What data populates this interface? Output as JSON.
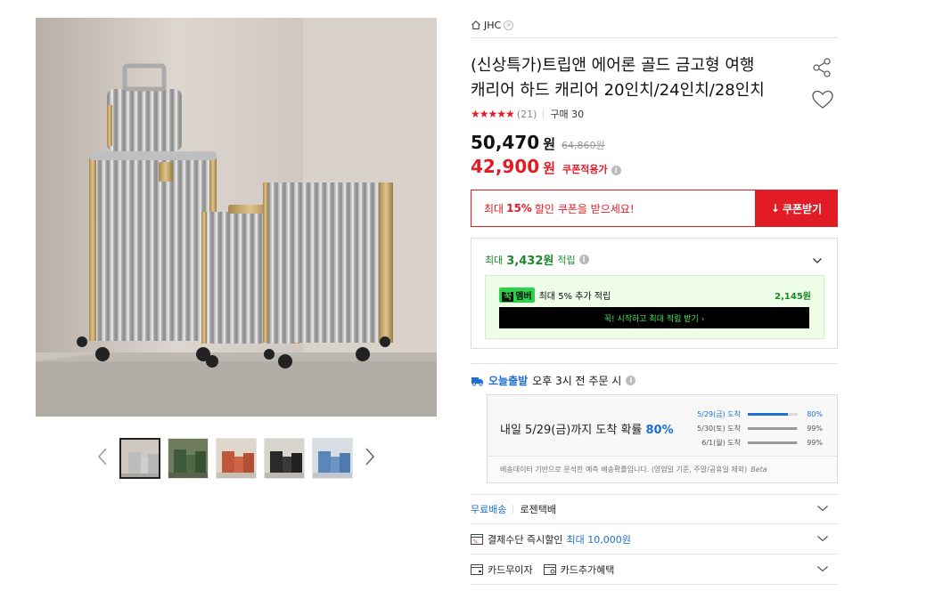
{
  "gallery": {
    "prev_arrow": "‹",
    "next_arrow": "›",
    "thumbnails": [
      "thumb-silver",
      "thumb-green",
      "thumb-orange",
      "thumb-black",
      "thumb-blue"
    ]
  },
  "brand": {
    "name": "JHC",
    "arrow": ">"
  },
  "product": {
    "title_line1": "(신상특가)트립앤 에어론 골드 금고형 여행",
    "title_line2": "캐리어 하드 캐리어 20인치/24인치/28인치",
    "stars": "★★★★★",
    "review_count": "(21)",
    "purchase": "구매 30"
  },
  "price": {
    "sale": "50,470",
    "won": "원",
    "original": "64,860원",
    "coupon_price": "42,900",
    "coupon_label": "쿠폰적용가",
    "info_icon": "i"
  },
  "coupon": {
    "msg_pre": "최대",
    "msg_pct": "15%",
    "msg_post": "할인 쿠폰을 받으세요!",
    "button": "쿠폰받기",
    "button_icon": "↓"
  },
  "points": {
    "pre": "최대",
    "amount": "3,432원",
    "post": "적립",
    "member_badge_k": "꾹",
    "member_badge": "멤버",
    "member_text": "최대 5% 추가 적립",
    "member_amount": "2,145원",
    "cta": "꾹! 시작하고 최대 적립 받기 ›"
  },
  "shipping": {
    "today_label": "오늘출발",
    "today_desc": "오후 3시 전 주문 시",
    "main_pre": "내일 5/29(금)까지 도착 확률",
    "main_pct": "80%",
    "rows": [
      {
        "date": "5/29(금) 도착",
        "pct": "80%",
        "value": 0.8
      },
      {
        "date": "5/30(토) 도착",
        "pct": "99%",
        "value": 0.99
      },
      {
        "date": "6/1(월) 도착",
        "pct": "99%",
        "value": 0.99
      }
    ],
    "note": "배송데이터 기반으로 분석한 예측 배송확률입니다. (영업일 기준, 주말/공휴일 제외)",
    "beta": "Beta"
  },
  "delivery": {
    "free": "무료배송",
    "carrier": "로젠택배"
  },
  "payment": {
    "label": "결제수단 즉시할인",
    "highlight": "최대 10,000원"
  },
  "card": {
    "interest_free": "카드무이자",
    "extra_benefit": "카드추가혜택"
  }
}
